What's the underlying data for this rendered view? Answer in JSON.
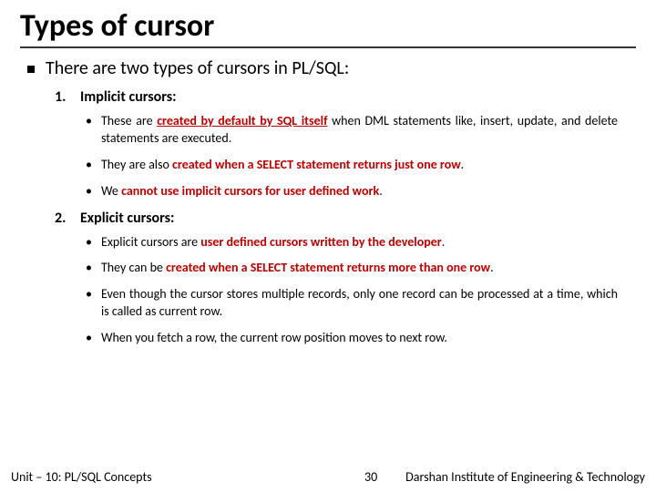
{
  "title": "Types of cursor",
  "intro": "There are two types of cursors in PL/SQL:",
  "sections": [
    {
      "num": "1.",
      "heading": "Implicit cursors:",
      "points": [
        {
          "pre": "These are ",
          "em": "created by default by SQL itself",
          "underline": true,
          "post": " when DML statements like, insert, update, and delete statements are executed."
        },
        {
          "pre": "They are also ",
          "em": "created when a SELECT statement returns just one row",
          "underline": false,
          "post": "."
        },
        {
          "pre": "We ",
          "em": "cannot use implicit cursors for user defined work",
          "underline": false,
          "post": "."
        }
      ]
    },
    {
      "num": "2.",
      "heading": "Explicit cursors:",
      "points": [
        {
          "pre": "Explicit cursors are ",
          "em": "user defined cursors written by the developer",
          "underline": false,
          "post": "."
        },
        {
          "pre": "They can be ",
          "em": "created when a SELECT statement returns more than one row",
          "underline": false,
          "post": "."
        },
        {
          "pre": "Even though the cursor stores multiple records, only one record can be processed at a time, which is called as current row.",
          "em": "",
          "underline": false,
          "post": ""
        },
        {
          "pre": "When you fetch a row, the current row position moves to next row.",
          "em": "",
          "underline": false,
          "post": ""
        }
      ]
    }
  ],
  "footer": {
    "left": "Unit – 10: PL/SQL Concepts",
    "page": "30",
    "right": "Darshan Institute of Engineering & Technology"
  }
}
